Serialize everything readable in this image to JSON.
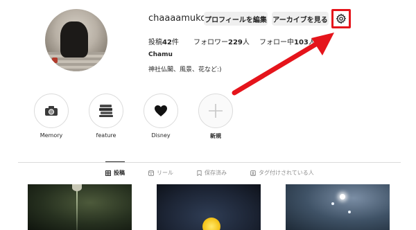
{
  "profile": {
    "username": "chaaaamuko",
    "edit_profile_label": "プロフィールを編集",
    "archive_label": "アーカイブを見る",
    "display_name": "Chamu",
    "bio": "神社仏閣、風景、花など:)"
  },
  "stats": {
    "posts_prefix": "投稿",
    "posts_count": "42",
    "posts_suffix": "件",
    "followers_prefix": "フォロワー",
    "followers_count": "229",
    "followers_suffix": "人",
    "following_prefix": "フォロー中",
    "following_count": "103",
    "following_suffix": "人"
  },
  "highlights": [
    {
      "label": "Memory",
      "icon": "camera-icon"
    },
    {
      "label": "feature",
      "icon": "books-icon"
    },
    {
      "label": "Disney",
      "icon": "heart-icon"
    },
    {
      "label": "新規",
      "icon": "plus-icon"
    }
  ],
  "tabs": [
    {
      "label": "投稿",
      "icon": "grid-icon",
      "active": true
    },
    {
      "label": "リール",
      "icon": "reel-icon",
      "active": false
    },
    {
      "label": "保存済み",
      "icon": "bookmark-icon",
      "active": false
    },
    {
      "label": "タグ付けされている人",
      "icon": "tag-person-icon",
      "active": false
    }
  ],
  "colors": {
    "annotation_red": "#e5141b",
    "button_bg": "#efefef",
    "text_primary": "#262626",
    "text_secondary": "#8e8e8e"
  }
}
